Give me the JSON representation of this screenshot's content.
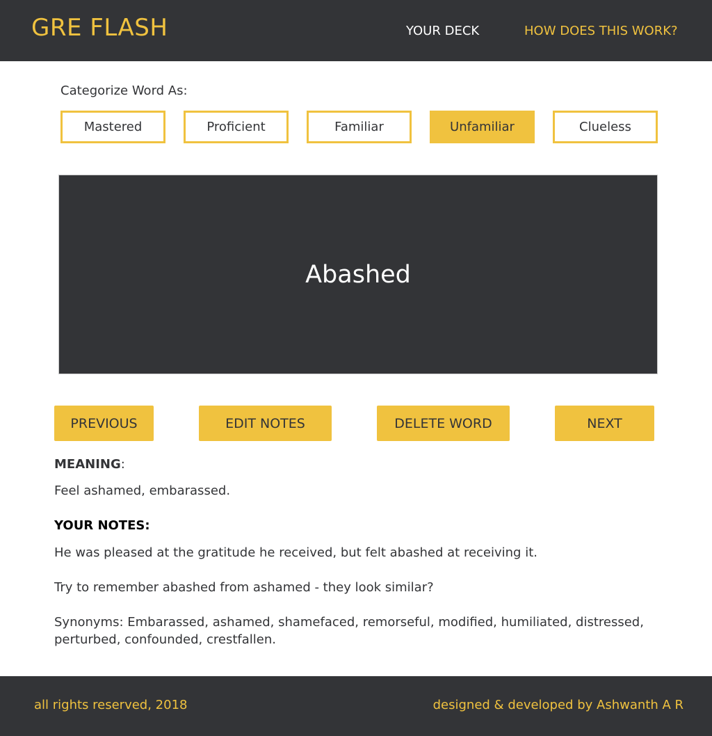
{
  "header": {
    "brand": "GRE FLASH",
    "nav": {
      "deck": "YOUR DECK",
      "how": "HOW DOES THIS WORK?"
    }
  },
  "categorize": {
    "label": "Categorize Word As:",
    "options": [
      "Mastered",
      "Proficient",
      "Familiar",
      "Unfamiliar",
      "Clueless"
    ],
    "selected": "Unfamiliar"
  },
  "card": {
    "word": "Abashed"
  },
  "actions": {
    "previous": "PREVIOUS",
    "edit_notes": "EDIT NOTES",
    "delete_word": "DELETE WORD",
    "next": "NEXT"
  },
  "meaning": {
    "heading": "MEANING",
    "text": "Feel ashamed, embarassed."
  },
  "notes": {
    "heading": "YOUR NOTES:",
    "items": [
      "He was pleased at the gratitude he received, but felt abashed at receiving it.",
      "Try to remember abashed from ashamed - they look similar?",
      "Synonyms: Embarassed, ashamed, shamefaced, remorseful, modified, humiliated, distressed, perturbed, confounded, crestfallen."
    ]
  },
  "footer": {
    "left": "all rights reserved, 2018",
    "right": "designed & developed by Ashwanth A R"
  },
  "colors": {
    "accent": "#f0c23f",
    "dark": "#333437"
  }
}
